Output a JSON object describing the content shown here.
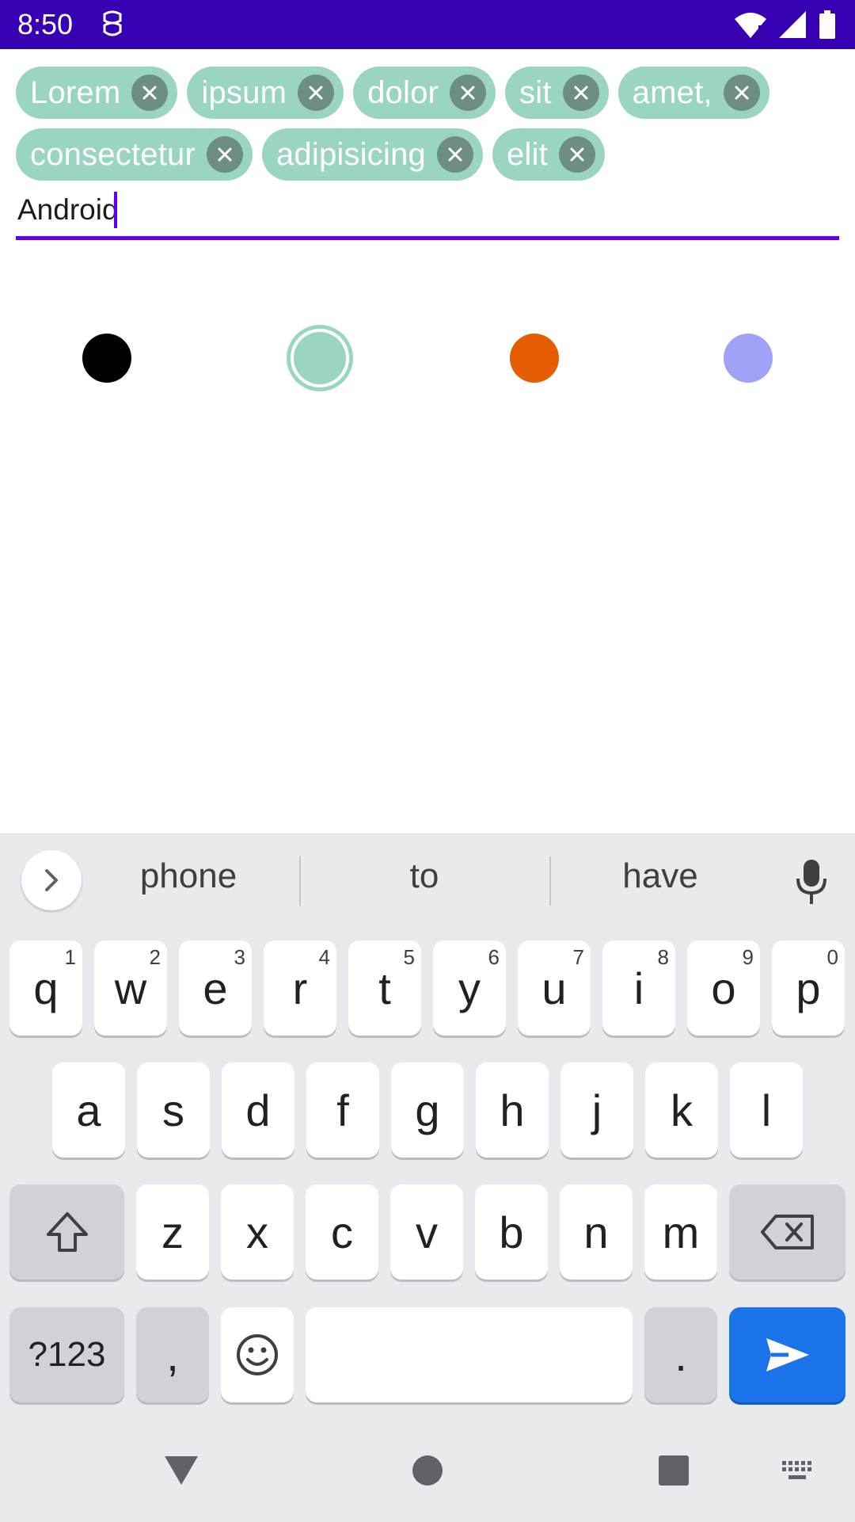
{
  "status_bar": {
    "time": "8:50",
    "bg_color": "#3700b3",
    "icons": [
      "notification-icon",
      "wifi-icon",
      "signal-icon",
      "battery-icon"
    ]
  },
  "chips": [
    {
      "label": "Lorem"
    },
    {
      "label": "ipsum"
    },
    {
      "label": "dolor"
    },
    {
      "label": "sit"
    },
    {
      "label": "amet,"
    },
    {
      "label": "consectetur"
    },
    {
      "label": "adipisicing"
    },
    {
      "label": "elit"
    }
  ],
  "chip_style": {
    "bg_color": "#9ad5c0",
    "close_bg_color": "#6f8e82"
  },
  "input": {
    "value": "Android",
    "accent_color": "#6200ee"
  },
  "color_options": [
    {
      "name": "black",
      "color": "#000000",
      "selected": false
    },
    {
      "name": "mint",
      "color": "#9ad5c0",
      "selected": true
    },
    {
      "name": "orange",
      "color": "#e65c00",
      "selected": false
    },
    {
      "name": "lavender",
      "color": "#a0a2f7",
      "selected": false
    }
  ],
  "keyboard": {
    "suggestions": [
      "phone",
      "to",
      "have"
    ],
    "row1": [
      {
        "key": "q",
        "hint": "1"
      },
      {
        "key": "w",
        "hint": "2"
      },
      {
        "key": "e",
        "hint": "3"
      },
      {
        "key": "r",
        "hint": "4"
      },
      {
        "key": "t",
        "hint": "5"
      },
      {
        "key": "y",
        "hint": "6"
      },
      {
        "key": "u",
        "hint": "7"
      },
      {
        "key": "i",
        "hint": "8"
      },
      {
        "key": "o",
        "hint": "9"
      },
      {
        "key": "p",
        "hint": "0"
      }
    ],
    "row2": [
      "a",
      "s",
      "d",
      "f",
      "g",
      "h",
      "j",
      "k",
      "l"
    ],
    "row3": [
      "z",
      "x",
      "c",
      "v",
      "b",
      "n",
      "m"
    ],
    "symbols_label": "?123",
    "comma_label": ",",
    "period_label": ".",
    "enter_color": "#1a73e8"
  }
}
